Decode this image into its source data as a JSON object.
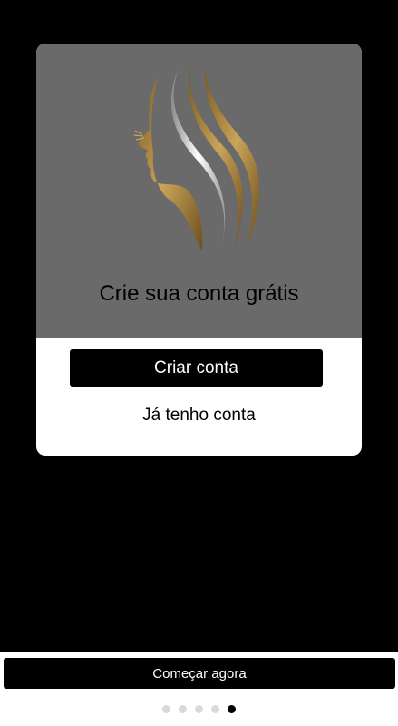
{
  "card": {
    "title": "Crie sua conta grátis",
    "create_account_label": "Criar conta",
    "have_account_label": "Já tenho conta"
  },
  "bottom": {
    "start_label": "Começar agora"
  },
  "pager": {
    "count": 5,
    "active_index": 4
  },
  "colors": {
    "background": "#000000",
    "hero": "#6a6a6a",
    "gold": "#b08a40",
    "silver": "#d0d0d0",
    "dot_inactive": "#d9d9d9",
    "dot_active": "#000000"
  },
  "icons": {
    "logo": "woman-profile-hair-logo"
  }
}
